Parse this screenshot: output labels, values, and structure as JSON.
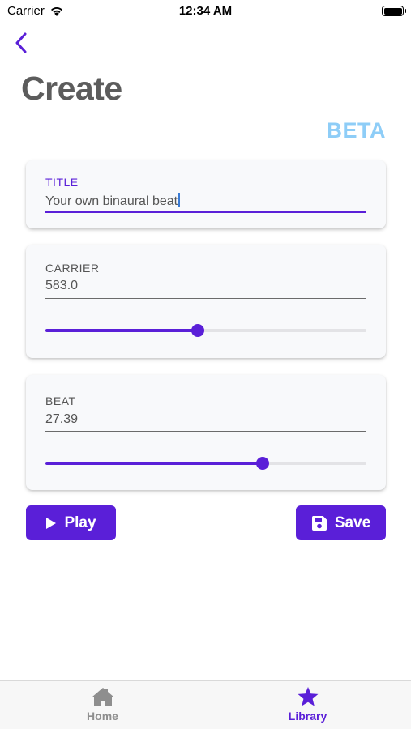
{
  "status_bar": {
    "carrier": "Carrier",
    "time": "12:34 AM"
  },
  "header": {
    "title": "Create",
    "badge": "BETA"
  },
  "title_field": {
    "label": "TITLE",
    "value": "Your own binaural beat"
  },
  "carrier_field": {
    "label": "CARRIER",
    "value": "583.0",
    "slider_fraction": 0.475
  },
  "beat_field": {
    "label": "BEAT",
    "value": "27.39",
    "slider_fraction": 0.678
  },
  "actions": {
    "play_label": "Play",
    "save_label": "Save"
  },
  "tab_bar": {
    "items": [
      {
        "label": "Home",
        "icon": "home-icon"
      },
      {
        "label": "Library",
        "icon": "star-icon"
      }
    ]
  },
  "colors": {
    "accent": "#5a1fd8",
    "badge": "#8ecdf7",
    "title": "#5c5c5c"
  }
}
